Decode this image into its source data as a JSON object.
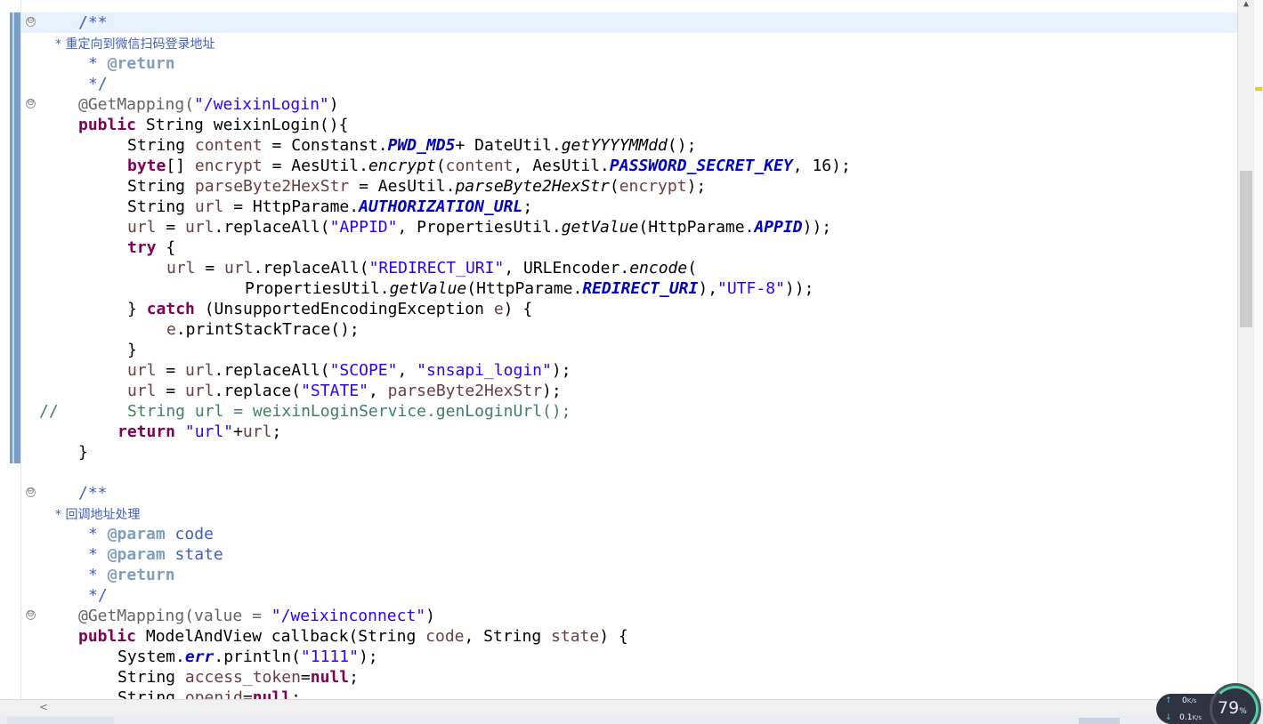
{
  "editor": {
    "lines": {
      "l1": "/**",
      "l2": "* 重定向到微信扫码登录地址",
      "l3_star": "* ",
      "l3_tag": "@return",
      "l4": "*/",
      "l5_ann": "@GetMapping(",
      "l5_str": "\"/weixinLogin\"",
      "l5_end": ")",
      "l6_kw": "public",
      "l6_rest": " String weixinLogin(){",
      "l7_a": "String ",
      "l7_var": "content",
      "l7_b": " = Constanst.",
      "l7_cst": "PWD_MD5",
      "l7_c": "+ DateUtil.",
      "l7_it": "getYYYYMMdd",
      "l7_d": "();",
      "l8_kw": "byte",
      "l8_a": "[] ",
      "l8_var": "encrypt",
      "l8_b": " = AesUtil.",
      "l8_it": "encrypt",
      "l8_c": "(",
      "l8_var2": "content",
      "l8_d": ", AesUtil.",
      "l8_cst": "PASSWORD_SECRET_KEY",
      "l8_e": ", 16);",
      "l9_a": "String ",
      "l9_var": "parseByte2HexStr",
      "l9_b": " = AesUtil.",
      "l9_it": "parseByte2HexStr",
      "l9_c": "(",
      "l9_var2": "encrypt",
      "l9_d": ");",
      "l10_a": "String ",
      "l10_var": "url",
      "l10_b": " = HttpParame.",
      "l10_cst": "AUTHORIZATION_URL",
      "l10_c": ";",
      "l11_var": "url",
      "l11_a": " = ",
      "l11_var2": "url",
      "l11_b": ".replaceAll(",
      "l11_str": "\"APPID\"",
      "l11_c": ", PropertiesUtil.",
      "l11_it": "getValue",
      "l11_d": "(HttpParame.",
      "l11_cst": "APPID",
      "l11_e": "));",
      "l12_kw": "try",
      "l12_a": " {",
      "l13_var": "url",
      "l13_a": " = ",
      "l13_var2": "url",
      "l13_b": ".replaceAll(",
      "l13_str": "\"REDIRECT_URI\"",
      "l13_c": ", URLEncoder.",
      "l13_it": "encode",
      "l13_d": "(",
      "l14_a": "PropertiesUtil.",
      "l14_it": "getValue",
      "l14_b": "(HttpParame.",
      "l14_cst": "REDIRECT_URI",
      "l14_c": "),",
      "l14_str": "\"UTF-8\"",
      "l14_d": "));",
      "l15_a": "} ",
      "l15_kw": "catch",
      "l15_b": " (UnsupportedEncodingException ",
      "l15_var": "e",
      "l15_c": ") {",
      "l16_var": "e",
      "l16_a": ".printStackTrace();",
      "l17": "}",
      "l18_var": "url",
      "l18_a": " = ",
      "l18_var2": "url",
      "l18_b": ".replaceAll(",
      "l18_str": "\"SCOPE\"",
      "l18_c": ", ",
      "l18_str2": "\"snsapi_login\"",
      "l18_d": ");",
      "l19_var": "url",
      "l19_a": " = ",
      "l19_var2": "url",
      "l19_b": ".replace(",
      "l19_str": "\"STATE\"",
      "l19_c": ", ",
      "l19_var3": "parseByte2HexStr",
      "l19_d": ");",
      "l20_slash": "//",
      "l20_cmt": "String url = weixinLoginService.genLoginUrl();",
      "l21_kw": "return",
      "l21_a": " ",
      "l21_str": "\"url\"",
      "l21_b": "+",
      "l21_var": "url",
      "l21_c": ";",
      "l22": "}",
      "l23": "/**",
      "l24": "* 回调地址处理",
      "l25_star": "* ",
      "l25_tag": "@param",
      "l25_p": " code",
      "l26_star": "* ",
      "l26_tag": "@param",
      "l26_p": " state",
      "l27_star": "* ",
      "l27_tag": "@return",
      "l28": "*/",
      "l29_ann": "@GetMapping(value = ",
      "l29_str": "\"/weixinconnect\"",
      "l29_end": ")",
      "l30_kw": "public",
      "l30_a": " ModelAndView callback(String ",
      "l30_var": "code",
      "l30_b": ", String ",
      "l30_var2": "state",
      "l30_c": ") {",
      "l31_a": "System.",
      "l31_fld": "err",
      "l31_b": ".println(",
      "l31_str": "\"1111\"",
      "l31_c": ");",
      "l32_a": "String ",
      "l32_var": "access_token",
      "l32_b": "=",
      "l32_kw": "null",
      "l32_c": ";",
      "l33_a": "String ",
      "l33_var": "openid",
      "l33_b": "=",
      "l33_kw": "null",
      "l33_c": ";"
    }
  },
  "folds": {
    "symbol": "⊖"
  },
  "scroll": {
    "up_arrow": "▲",
    "left_arrow": "<"
  },
  "net_monitor": {
    "upload_arrow": "↑",
    "upload_value": "0",
    "upload_unit": "K/s",
    "download_arrow": "↓",
    "download_value": "0.1",
    "download_unit": "K/s",
    "percent": "79",
    "percent_sign": "%",
    "ring_color": "#4fd1a5"
  },
  "colors": {
    "keyword": "#7f0055",
    "string": "#2a00ff",
    "javadoc": "#3f5fbf",
    "comment": "#3f7f5f",
    "constant": "#0000c0",
    "local_var": "#6a3e3e",
    "current_line": "#e8f2fe"
  }
}
